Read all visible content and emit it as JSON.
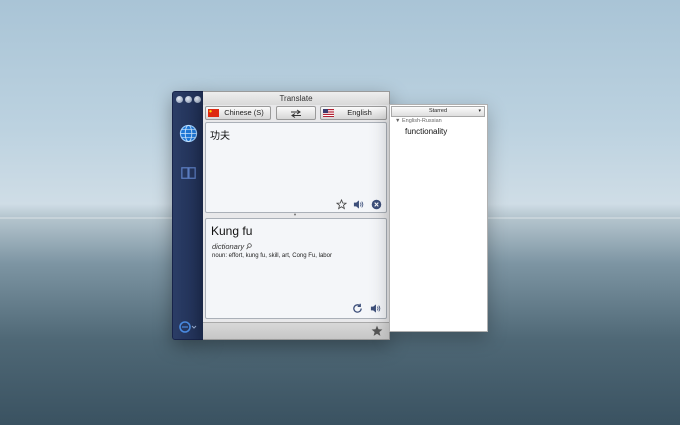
{
  "window": {
    "title": "Translate"
  },
  "languages": {
    "source": "Chinese (S)",
    "target": "English"
  },
  "source": {
    "text": "功夫"
  },
  "result": {
    "word": "Kung fu",
    "dictionary_label": "dictionary",
    "meaning": "noun: effort, kung fu, skill, art, Cong Fu, labor"
  },
  "starred": {
    "header": "Starred",
    "group": "English-Russian",
    "entries": [
      "functionality"
    ]
  },
  "icons": {
    "star": "star-icon",
    "speaker": "speaker-icon",
    "clear": "clear-icon",
    "refresh": "refresh-icon",
    "swap": "swap-arrows-icon",
    "globe": "globe-icon",
    "book": "dictionary-book-icon"
  },
  "colors": {
    "sidebar": "#24365e",
    "accent": "#2f6fd8",
    "flag_cn": "#de2910"
  }
}
